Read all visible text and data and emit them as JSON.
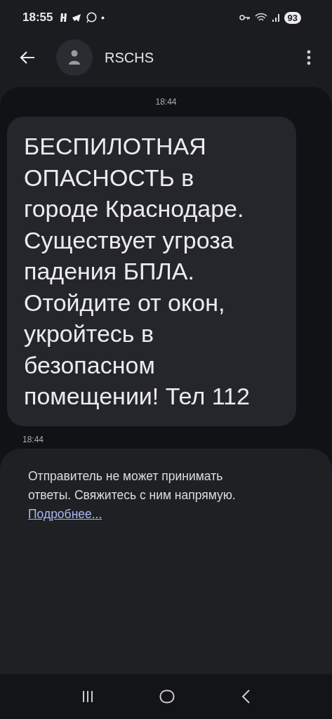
{
  "status_bar": {
    "time": "18:55",
    "battery": "93"
  },
  "header": {
    "title": "RSCHS"
  },
  "conversation": {
    "date_label": "18:44",
    "messages": [
      {
        "text": "БЕСПИЛОТНАЯ ОПАСНОСТЬ в городе Краснодаре. Существует угроза падения БПЛА. Отойдите от окон, укройтесь в безопасном помещении! Тел 112",
        "time": "18:44"
      }
    ]
  },
  "notice": {
    "text": "Отправитель не может принимать ответы. Свяжитесь с ним напрямую.",
    "link": "Подробнее..."
  }
}
